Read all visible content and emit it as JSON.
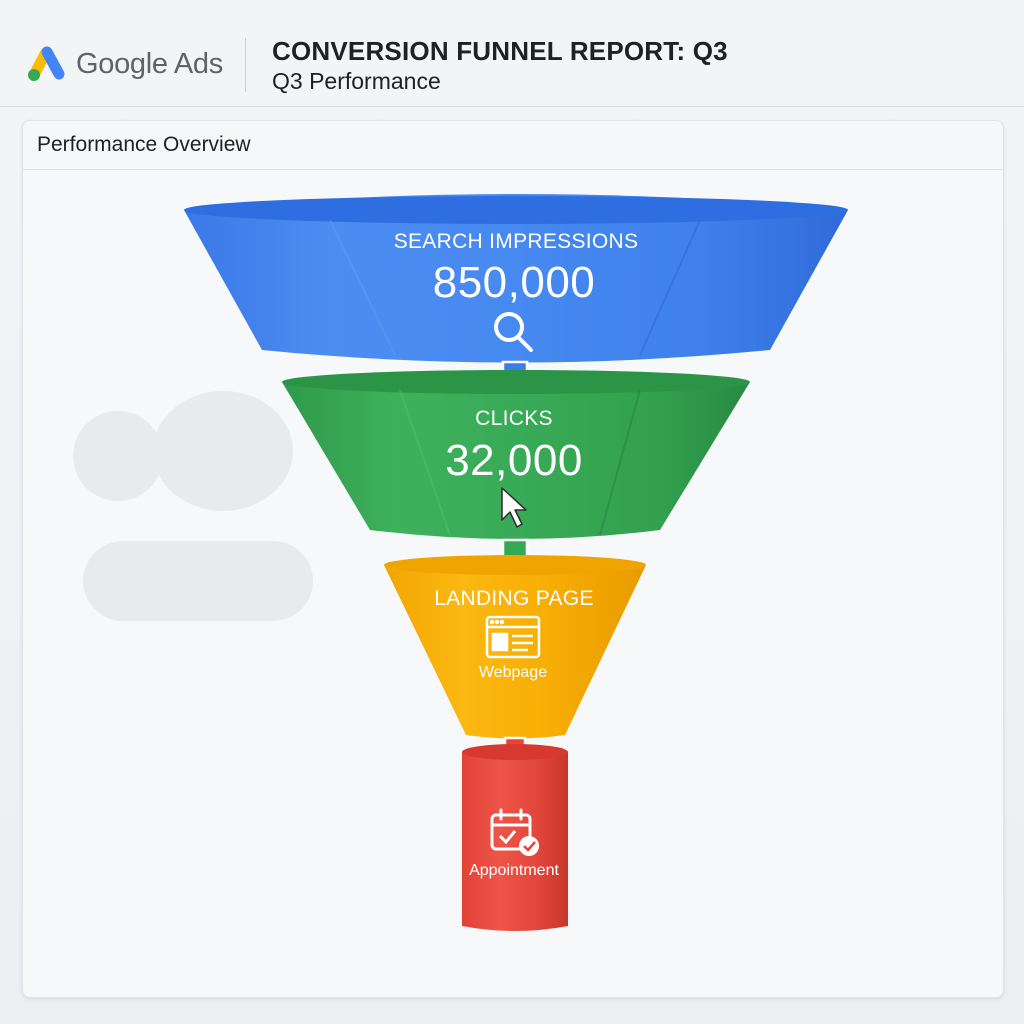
{
  "header": {
    "logo_text": "Google Ads",
    "title": "CONVERSION FUNNEL REPORT: Q3",
    "subtitle": "Q3 Performance"
  },
  "card": {
    "title": "Performance Overview"
  },
  "funnel": {
    "stages": [
      {
        "label": "SEARCH IMPRESSIONS",
        "value": "850,000",
        "icon": "search-icon",
        "color": "#4285F4"
      },
      {
        "label": "CLICKS",
        "value": "32,000",
        "icon": "cursor-icon",
        "color": "#34A853"
      },
      {
        "label": "LANDING PAGE",
        "sub_label": "Webpage",
        "icon": "webpage-icon",
        "color": "#F9AB00"
      },
      {
        "sub_label": "Appointment",
        "icon": "calendar-check-icon",
        "color": "#EA4335"
      }
    ]
  },
  "colors": {
    "google_blue": "#4285F4",
    "google_green": "#34A853",
    "google_yellow": "#FBBC04",
    "google_red": "#EA4335"
  }
}
